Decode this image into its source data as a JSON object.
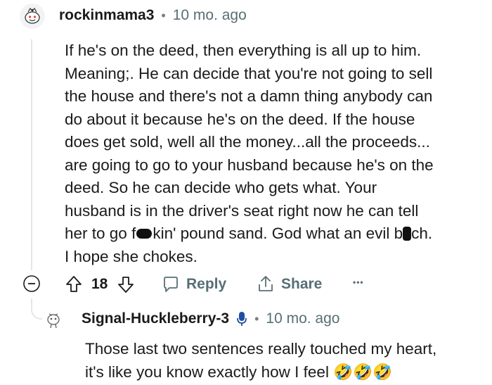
{
  "comment": {
    "username": "rockinmama3",
    "separator": "•",
    "age": "10 mo. ago",
    "lines": [
      "If he's on the deed, then everything is all up to him.",
      "Meaning;. He can decide that you're not going to sell",
      "the house and there's not a damn thing anybody can",
      "do about it because he's on the deed. If the house",
      "does get sold, well all the money...all the proceeds...",
      "are going to go to your husband because he's on the",
      "deed. So he can decide who gets what. Your",
      "husband is in the driver's seat right now he can tell"
    ],
    "line9": {
      "a": "her to go f",
      "b": "kin' pound sand. God what an evil b",
      "c": "ch."
    },
    "line10": "I hope she chokes."
  },
  "actions": {
    "vote_count": "18",
    "reply_label": "Reply",
    "share_label": "Share",
    "more_label": "•••"
  },
  "reply": {
    "username": "Signal-Huckleberry-3",
    "separator": "•",
    "age": "10 mo. ago",
    "line1": "Those last two sentences really touched my heart,",
    "line2": "it's like you know exactly how I feel",
    "emojis": [
      "🤣",
      "🤣",
      "🤣"
    ]
  },
  "colors": {
    "meta": "#576f76",
    "text": "#1a1a1b",
    "thread": "#e4e6e8"
  }
}
